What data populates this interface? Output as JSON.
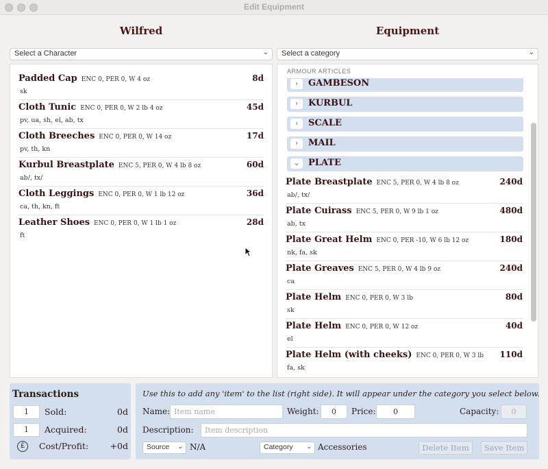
{
  "window": {
    "title": "Edit Equipment"
  },
  "left": {
    "heading": "Wilfred",
    "select_placeholder": "Select a Character",
    "items": [
      {
        "name": "Padded Cap",
        "stats": "ENC 0, PER 0, W  4 oz",
        "tags": "sk",
        "price": "8d"
      },
      {
        "name": "Cloth Tunic",
        "stats": "ENC 0, PER 0, W 2 lb 4 oz",
        "tags": "pv, ua, sh, el, ab, tx",
        "price": "45d"
      },
      {
        "name": "Cloth Breeches",
        "stats": "ENC 0, PER 0, W  14 oz",
        "tags": "pv, th, kn",
        "price": "17d"
      },
      {
        "name": "Kurbul Breastplate",
        "stats": "ENC 5, PER 0, W 4 lb 8 oz",
        "tags": "ab/, tx/",
        "price": "60d"
      },
      {
        "name": "Cloth Leggings",
        "stats": "ENC 0, PER 0, W 1 lb 12 oz",
        "tags": "ca, th, kn, ft",
        "price": "36d"
      },
      {
        "name": "Leather Shoes",
        "stats": "ENC 0, PER 0, W 1 lb 1 oz",
        "tags": "ft",
        "price": "28d"
      }
    ]
  },
  "right": {
    "heading": "Equipment",
    "select_placeholder": "Select a category",
    "section_label": "ARMOUR ARTICLES",
    "categories": [
      {
        "name": "GAMBESON",
        "toggle": "›"
      },
      {
        "name": "KURBUL",
        "toggle": "›"
      },
      {
        "name": "SCALE",
        "toggle": "›"
      },
      {
        "name": "MAIL",
        "toggle": "›"
      },
      {
        "name": "PLATE",
        "toggle": "⌄"
      }
    ],
    "items": [
      {
        "name": "Plate Breastplate",
        "stats": "ENC 5, PER 0, W 4 lb 8 oz",
        "tags": "ab/, tx/",
        "price": "240d"
      },
      {
        "name": "Plate Cuirass",
        "stats": "ENC 5, PER 0, W 9 lb 1 oz",
        "tags": "ab, tx",
        "price": "480d"
      },
      {
        "name": "Plate Great Helm",
        "stats": "ENC 0, PER -10, W 6 lb 12 oz",
        "tags": "nk, fa, sk",
        "price": "180d"
      },
      {
        "name": "Plate Greaves",
        "stats": "ENC 5, PER 0, W 4 lb 9 oz",
        "tags": "ca",
        "price": "240d"
      },
      {
        "name": "Plate Helm",
        "stats": "ENC 0, PER 0, W 3 lb",
        "tags": "sk",
        "price": "80d"
      },
      {
        "name": "Plate Helm",
        "stats": "ENC 0, PER 0, W  12 oz",
        "tags": "el",
        "price": "40d"
      },
      {
        "name": "Plate Helm (with cheeks)",
        "stats": "ENC 0, PER 0, W 3 lb",
        "tags": "fa, sk",
        "price": "110d"
      }
    ]
  },
  "transactions": {
    "title": "Transactions",
    "sold_qty": "1",
    "sold_label": "Sold:",
    "sold_value": "0d",
    "acquired_qty": "1",
    "acquired_label": "Acquired:",
    "acquired_value": "0d",
    "icon": "£",
    "cost_label": "Cost/Profit:",
    "cost_value": "+0d"
  },
  "add_item": {
    "instruction": "Use this to add any 'item' to the list (right side). It will appear under the category you select below.",
    "name_label": "Name:",
    "name_placeholder": "Item name",
    "weight_label": "Weight:",
    "weight_value": "0",
    "price_label": "Price:",
    "price_value": "0",
    "capacity_label": "Capacity:",
    "capacity_value": "0",
    "description_label": "Description:",
    "description_placeholder": "Item description",
    "source_select": "Source",
    "source_value": "N/A",
    "category_select": "Category",
    "category_value": "Accessories",
    "delete_label": "Delete Item",
    "save_label": "Save Item"
  }
}
